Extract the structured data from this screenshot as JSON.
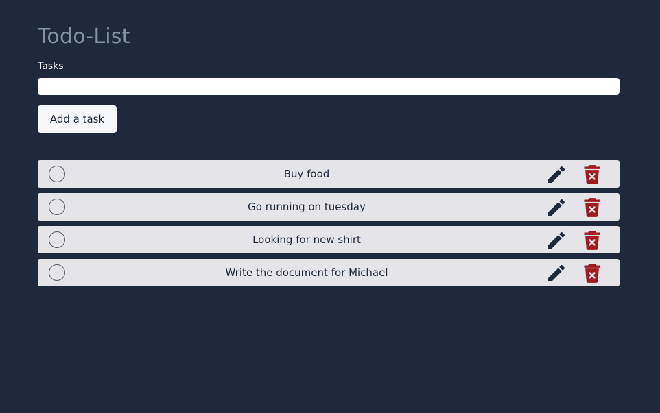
{
  "header": {
    "title": "Todo-List"
  },
  "form": {
    "field_label": "Tasks",
    "input_value": "",
    "add_button_label": "Add a task"
  },
  "icons": {
    "complete": "circle-icon",
    "edit": "pencil-icon",
    "delete": "trash-icon"
  },
  "colors": {
    "background": "#1e293b",
    "title": "#8193ab",
    "row_background": "#e5e4e8",
    "edit_icon": "#1e293b",
    "delete_icon": "#a11a1f"
  },
  "tasks": [
    {
      "text": "Buy food"
    },
    {
      "text": "Go running on tuesday"
    },
    {
      "text": "Looking for new shirt"
    },
    {
      "text": "Write the document for Michael"
    }
  ]
}
